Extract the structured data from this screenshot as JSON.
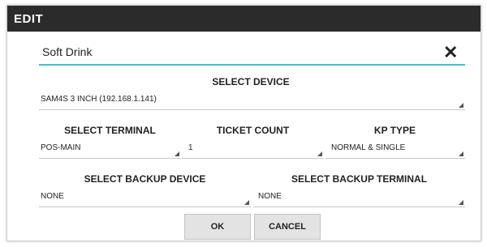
{
  "dialog": {
    "title": "EDIT",
    "name_value": "Soft Drink"
  },
  "device": {
    "label": "SELECT DEVICE",
    "value": "SAM4S 3 INCH (192.168.1.141)"
  },
  "terminal": {
    "label": "SELECT TERMINAL",
    "value": "POS-MAIN"
  },
  "ticket_count": {
    "label": "TICKET COUNT",
    "value": "1"
  },
  "kp_type": {
    "label": "KP TYPE",
    "value": "NORMAL & SINGLE"
  },
  "backup_device": {
    "label": "SELECT BACKUP DEVICE",
    "value": "NONE"
  },
  "backup_terminal": {
    "label": "SELECT BACKUP TERMINAL",
    "value": "NONE"
  },
  "buttons": {
    "ok": "OK",
    "cancel": "CANCEL"
  },
  "icons": {
    "close": "close-icon",
    "dropdown": "dropdown-triangle-icon"
  },
  "colors": {
    "titlebar": "#2b2b2b",
    "focus_underline": "#52b8cf",
    "button_bg": "#e3e3e3"
  }
}
